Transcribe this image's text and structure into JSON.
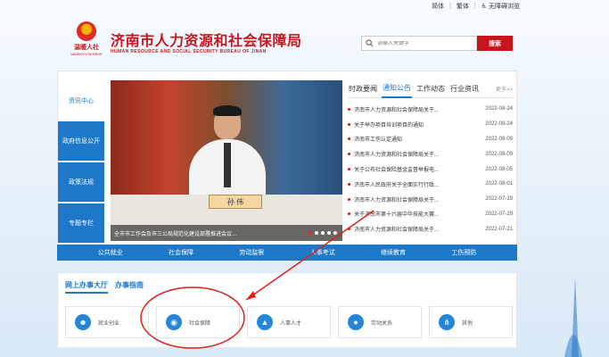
{
  "topbar": {
    "simplified": "简体",
    "traditional": "繁体",
    "accessibility": "无障碍浏览"
  },
  "header": {
    "logo_text": "温暖人社",
    "logo_sub": "WARMTH RENSHE",
    "title": "济南市人力资源和社会保障局",
    "subtitle": "HUMAN RESOURCE AND SOCIAL SECURITY BUREAU OF JINAN"
  },
  "search": {
    "placeholder": "请输入关键字",
    "button": "搜索"
  },
  "leftnav": {
    "items": [
      "资讯中心",
      "政府信息公开",
      "政策法规",
      "专题专栏"
    ]
  },
  "slide": {
    "nameplate": "孙 伟",
    "caption": "全市市工作会及市三公局规范化建设部署推进会议..."
  },
  "news": {
    "tabs": [
      "时政要闻",
      "通知公告",
      "工作动态",
      "行业资讯"
    ],
    "more": "更多>>",
    "items": [
      {
        "title": "济南市人力资源和社会保障局关于...",
        "date": "2022-08-24"
      },
      {
        "title": "关于举办项目培训项目的通知",
        "date": "2022-08-24"
      },
      {
        "title": "济南市工伤认定通知",
        "date": "2022-08-09"
      },
      {
        "title": "济南市人力资源和社会保障局关于...",
        "date": "2022-08-09"
      },
      {
        "title": "关于公布社会保险基金监督举报电...",
        "date": "2022-08-05"
      },
      {
        "title": "济南市人民政府关于全面实行行政...",
        "date": "2022-08-01"
      },
      {
        "title": "济南市人力资源和社会保障局关于...",
        "date": "2022-07-29"
      },
      {
        "title": "关于济南市第十六届中华技能大赛...",
        "date": "2022-07-29"
      },
      {
        "title": "济南市人力资源和社会保障局关于...",
        "date": "2022-07-21"
      }
    ]
  },
  "menubar": {
    "items": [
      "公共就业",
      "社会保障",
      "劳动监察",
      "人事考试",
      "继续教育",
      "工伤预防"
    ]
  },
  "services": {
    "tabs": [
      "网上办事大厅",
      "办事指南"
    ],
    "items": [
      {
        "label": "就业创业",
        "icon": "user-group-icon"
      },
      {
        "label": "社会保障",
        "icon": "eye-icon"
      },
      {
        "label": "人事人才",
        "icon": "graduation-cap-icon"
      },
      {
        "label": "劳动关系",
        "icon": "person-icon"
      },
      {
        "label": "其他",
        "icon": "share-icon"
      }
    ]
  },
  "colors": {
    "brand_red": "#c8161d",
    "brand_blue": "#1d78c9",
    "annotation_red": "#e0201a"
  }
}
